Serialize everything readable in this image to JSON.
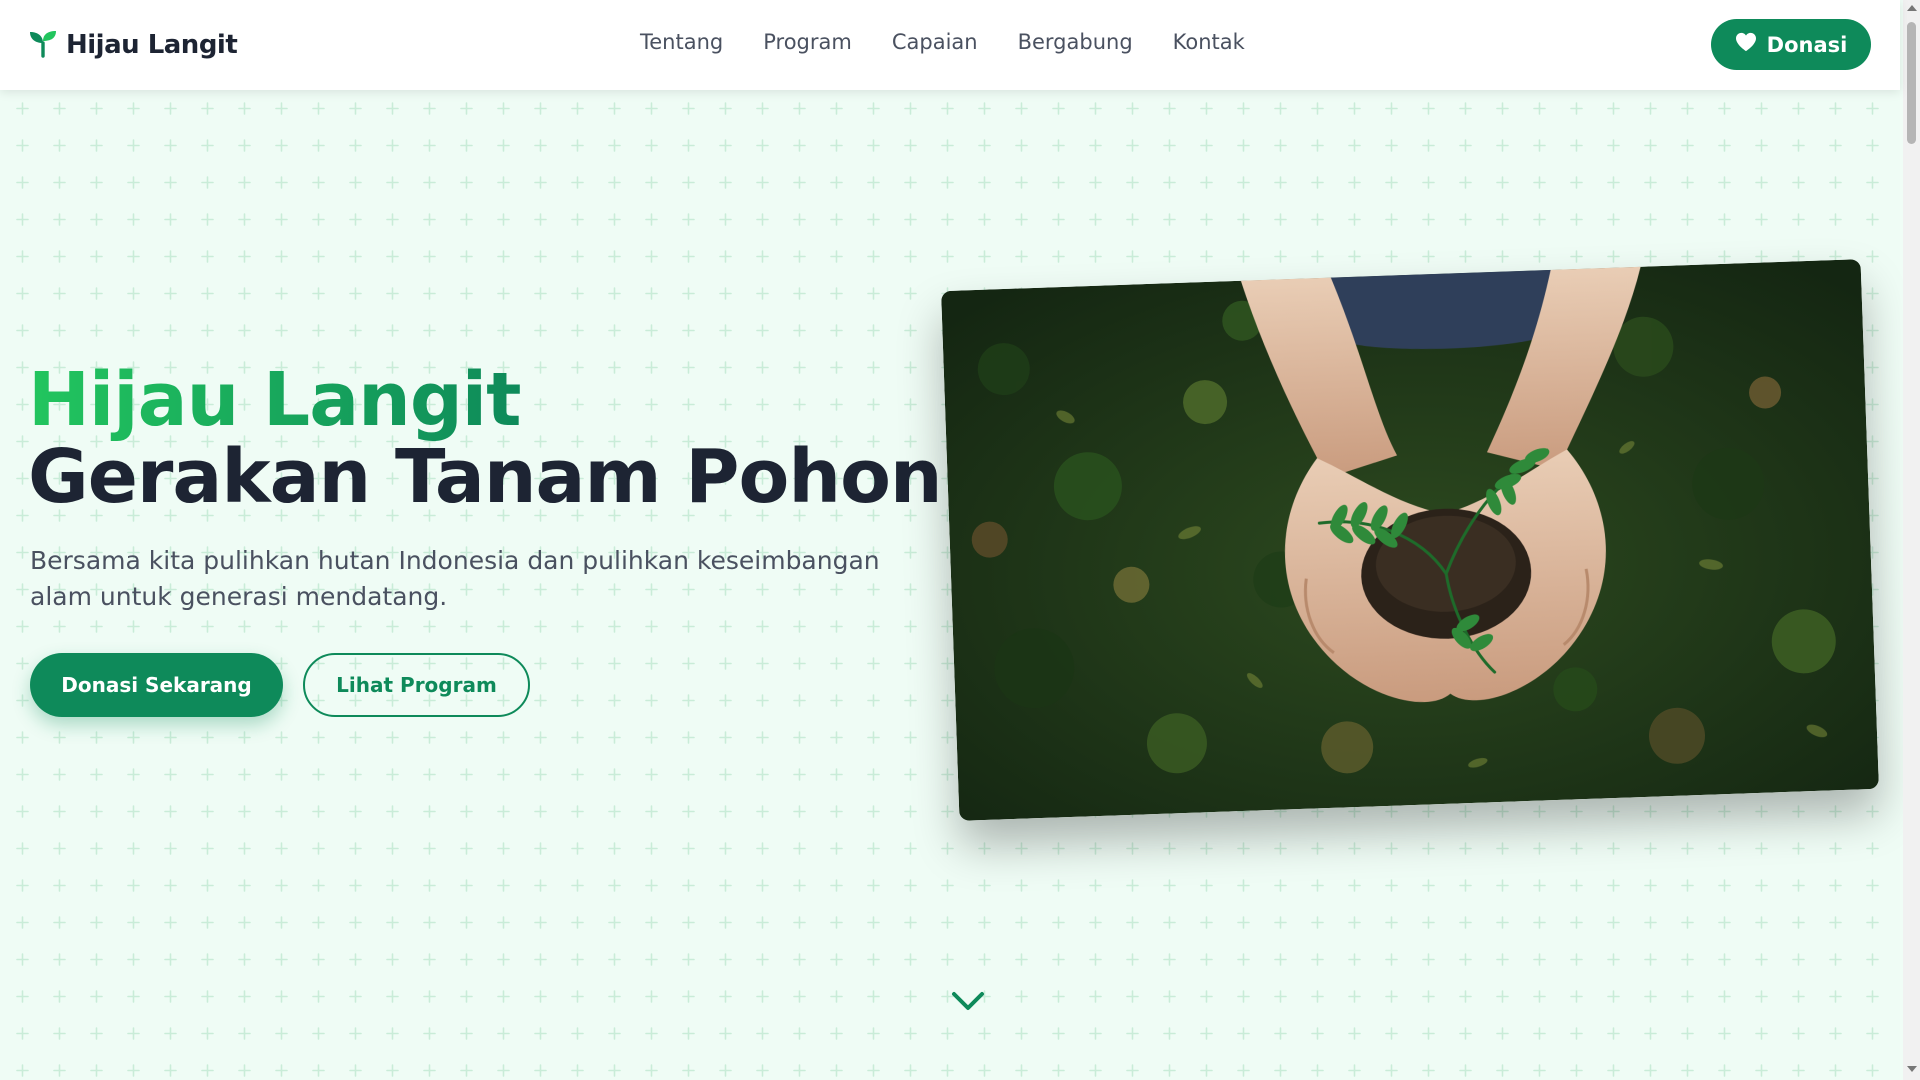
{
  "nav": {
    "brand": "Hijau Langit",
    "links": [
      "Tentang",
      "Program",
      "Capaian",
      "Bergabung",
      "Kontak"
    ],
    "donate_label": "Donasi"
  },
  "hero": {
    "title_line1": "Hijau Langit",
    "title_line2": "Gerakan Tanam Pohon",
    "subtitle": "Bersama kita pulihkan hutan Indonesia dan pulihkan keseimbangan alam untuk generasi mendatang.",
    "primary_cta": "Donasi Sekarang",
    "secondary_cta": "Lihat Program"
  },
  "colors": {
    "primary": "#0e8a5a",
    "accent": "#22c55e",
    "heading": "#1d2433",
    "background": "#effcf5"
  },
  "icons": {
    "brand": "seedling-icon",
    "donate": "heart-icon",
    "scroll": "chevron-down-icon"
  }
}
